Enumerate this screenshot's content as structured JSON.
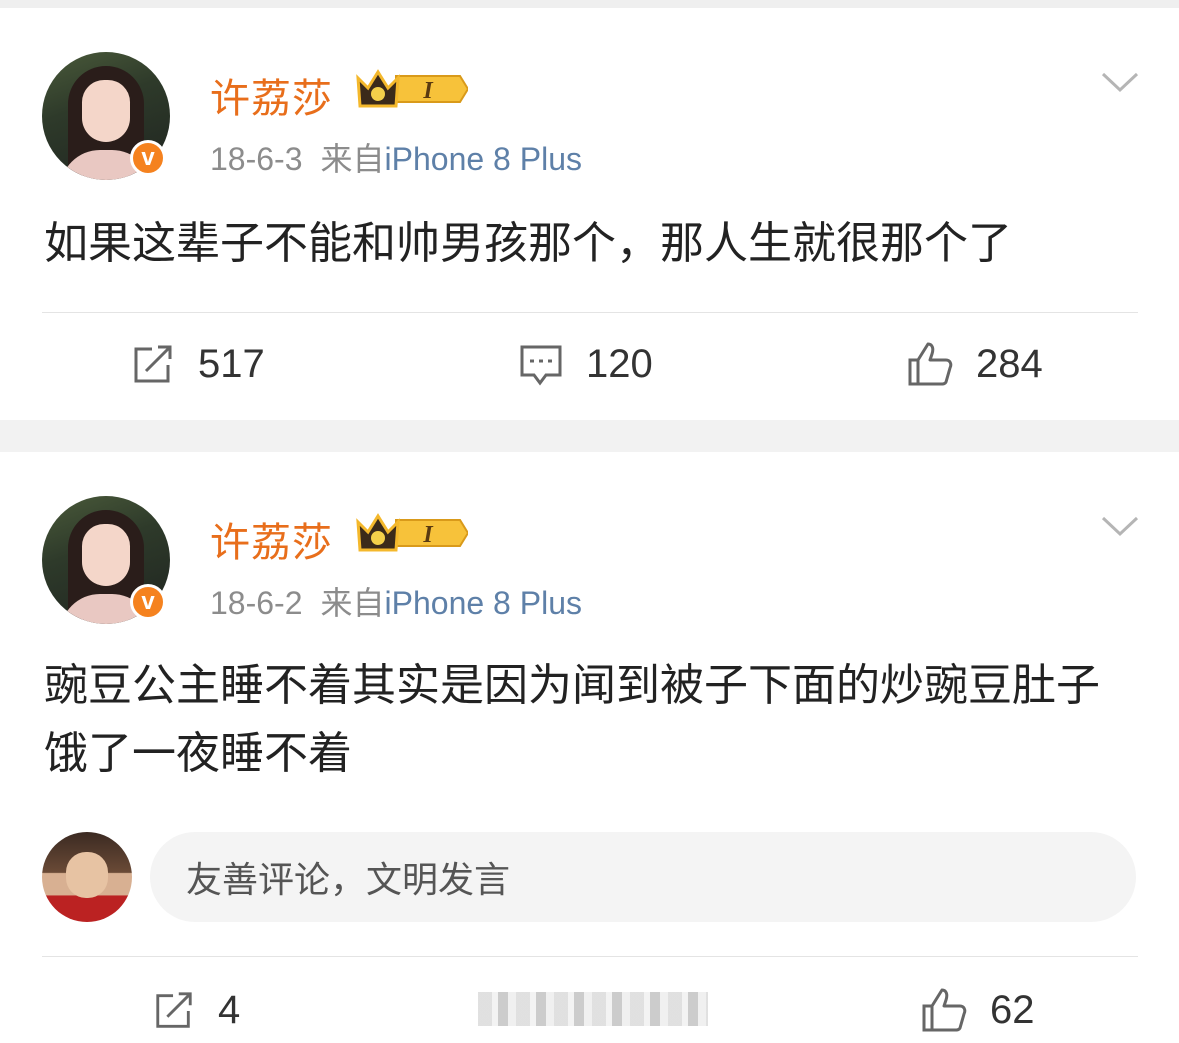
{
  "posts": [
    {
      "username": "许荔莎",
      "vip_level": "I",
      "date": "18-6-3",
      "source_prefix": "来自",
      "device": "iPhone 8 Plus",
      "text": "如果这辈子不能和帅男孩那个，那人生就很那个了",
      "reposts": "517",
      "comments": "120",
      "likes": "284"
    },
    {
      "username": "许荔莎",
      "vip_level": "I",
      "date": "18-6-2",
      "source_prefix": "来自",
      "device": "iPhone 8 Plus",
      "text": "豌豆公主睡不着其实是因为闻到被子下面的炒豌豆肚子饿了一夜睡不着",
      "comment_placeholder": "友善评论，文明发言",
      "reposts": "4",
      "likes": "62"
    }
  ],
  "icons": {
    "verified": "v",
    "crown": "crown-icon",
    "menu": "chevron-down-icon",
    "repost": "repost-icon",
    "comment": "comment-icon",
    "like": "like-icon"
  },
  "colors": {
    "username": "#e86e1b",
    "device": "#5e80a8",
    "meta": "#8c8c8c",
    "badge": "#f5821f"
  }
}
